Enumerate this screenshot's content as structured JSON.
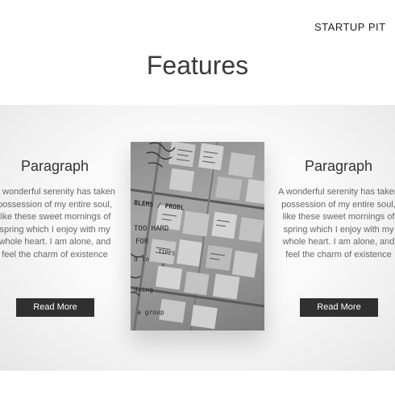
{
  "header": {
    "brand": "STARTUP PIT"
  },
  "section": {
    "title": "Features"
  },
  "features": [
    {
      "heading": "Paragraph",
      "text": "A wonderful serenity has taken possession of my entire soul, like these sweet mornings of spring which I enjoy with my whole heart. I am alone, and feel the charm of existence",
      "button": "Read More"
    },
    {
      "heading": "Paragraph",
      "text": "A wonderful serenity has taken possession of my entire soul, like these sweet mornings of spring which I enjoy with my whole heart. I am alone, and feel the charm of existence",
      "button": "Read More"
    }
  ],
  "image": {
    "subject": "whiteboard-with-sticky-notes-photo",
    "handwriting": [
      "BLEMS / PROBL",
      "TOO HARD",
      "TIRES",
      "x",
      "FOR",
      "d to",
      "doing",
      "a group"
    ]
  },
  "colors": {
    "button_bg": "#303030",
    "button_text": "#ffffff",
    "title": "#3b3b3b",
    "body_text": "#666666"
  }
}
